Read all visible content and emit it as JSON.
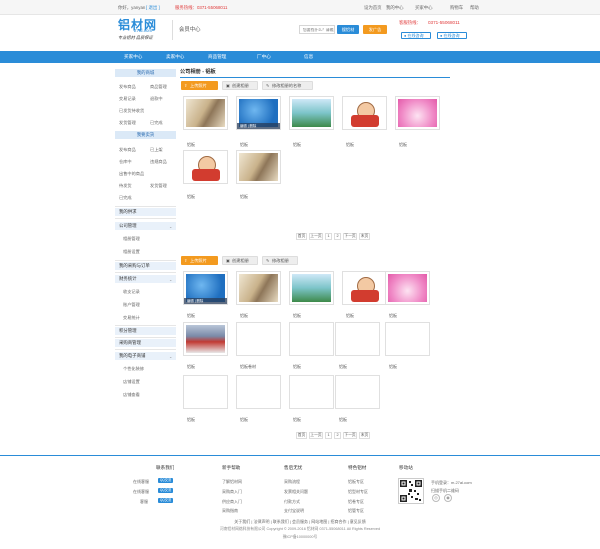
{
  "topbar": {
    "welcome": "你好，yanyan",
    "logout": "[ 退出 ]",
    "hotline": "服务热线：0371-55068011",
    "set_home": "设为首页",
    "my_center": "我的中心",
    "buyer_center": "买家中心",
    "cart": "购物车",
    "help": "帮助"
  },
  "logo": {
    "name": "铝材网",
    "domain": "27al.com",
    "slogan": "专业铝材 品质保证"
  },
  "member_center": "会员中心",
  "search": {
    "placeholder": "您要找什么？请输入铝材名称",
    "button": "搜铝材",
    "post": "发广告"
  },
  "service": {
    "hot_label": "客服热线：",
    "hot_number": "0371-55068011",
    "online1": "在线咨询",
    "online2": "在线咨询"
  },
  "nav": {
    "items": [
      "买家中心",
      "卖家中心",
      "商品管理",
      "厂中心",
      "信息"
    ]
  },
  "sidebar": {
    "h1": "我的商城",
    "row1": [
      "发布商品",
      "商品管理"
    ],
    "row2": [
      "交易记录",
      "退款中"
    ],
    "row3_single": "已发货待收货",
    "row4": [
      "发货管理",
      "已完成"
    ],
    "h2": "我要卖货",
    "row5": [
      "发布商品",
      "已上架"
    ],
    "row6": [
      "仓库中",
      "违规商品"
    ],
    "row7_single": "出售中的商品",
    "row8": [
      "待发货",
      "发货管理"
    ],
    "row9_single": "已完成",
    "h3": "我的供求",
    "h4": "公司管理",
    "row10": "相册管理",
    "row11": "相册设置",
    "h5": "我的采购与订单",
    "h6": "财务统计",
    "row12": "收支记录",
    "row13": "账户管理",
    "row14": "交易统计",
    "h7": "积分管理",
    "h8": "采购商管理",
    "h9": "我的电子商铺",
    "row15": "个性化装修",
    "row16": "店铺设置",
    "row17": "店铺查看"
  },
  "page": {
    "title": "公司相册 - 铝板"
  },
  "section1": {
    "tabs": [
      "上传照片",
      "创建相册",
      "修改相册的名称"
    ],
    "captions": [
      "铝板",
      "铝板",
      "铝板",
      "铝板",
      "铝板",
      "铝板",
      "铝板"
    ],
    "tile_actions": "编辑 | 删除",
    "pager": [
      "首页",
      "上一页",
      "1",
      "2",
      "下一页",
      "末页"
    ]
  },
  "section2": {
    "tabs": [
      "上传照片",
      "创建相册",
      "修改相册"
    ],
    "captions": [
      "铝板",
      "铝板",
      "铝板",
      "铝板",
      "铝板",
      "铝板",
      "铝板卷材",
      "铝板",
      "铝板",
      "铝板",
      "铝板",
      "铝板",
      "铝板",
      "铝板"
    ],
    "tile_actions": "编辑 | 删除",
    "pager": [
      "首页",
      "上一页",
      "1",
      "2",
      "下一页",
      "末页"
    ]
  },
  "footer": {
    "cols": [
      {
        "title": "联系我们",
        "links": [
          "在线客服",
          "在线客服",
          "客服"
        ]
      },
      {
        "title": "新手帮助",
        "links": [
          "了解铝材网",
          "采购商入门",
          "供应商入门",
          "采购指南"
        ]
      },
      {
        "title": "售后无忧",
        "links": [
          "采购流程",
          "发票相关问题",
          "付款方式",
          "支付宝说明"
        ]
      },
      {
        "title": "特色铝材",
        "links": [
          "铝板专区",
          "铝型材专区",
          "铝卷专区",
          "铝管专区"
        ]
      },
      {
        "title": "移动站",
        "links": [
          "手机登录：m.27al.com",
          "扫描手机二维码"
        ]
      }
    ],
    "qq_label": "QQ交流",
    "bottom_links": "关于我们 | 法律声明 | 联系我们 | 会员服务 | 网站地图 | 招商合作 | 意见反馈",
    "copyright": "河南铝材网络科技有限公司 Copyright © 2009-2016 铝材网 0371-55068011 All Rights Reserved",
    "icp": "豫ICP备10000000号"
  },
  "colors": {
    "brand": "#2a8cd8",
    "accent": "#f39a1f",
    "alert": "#e03a3a"
  }
}
